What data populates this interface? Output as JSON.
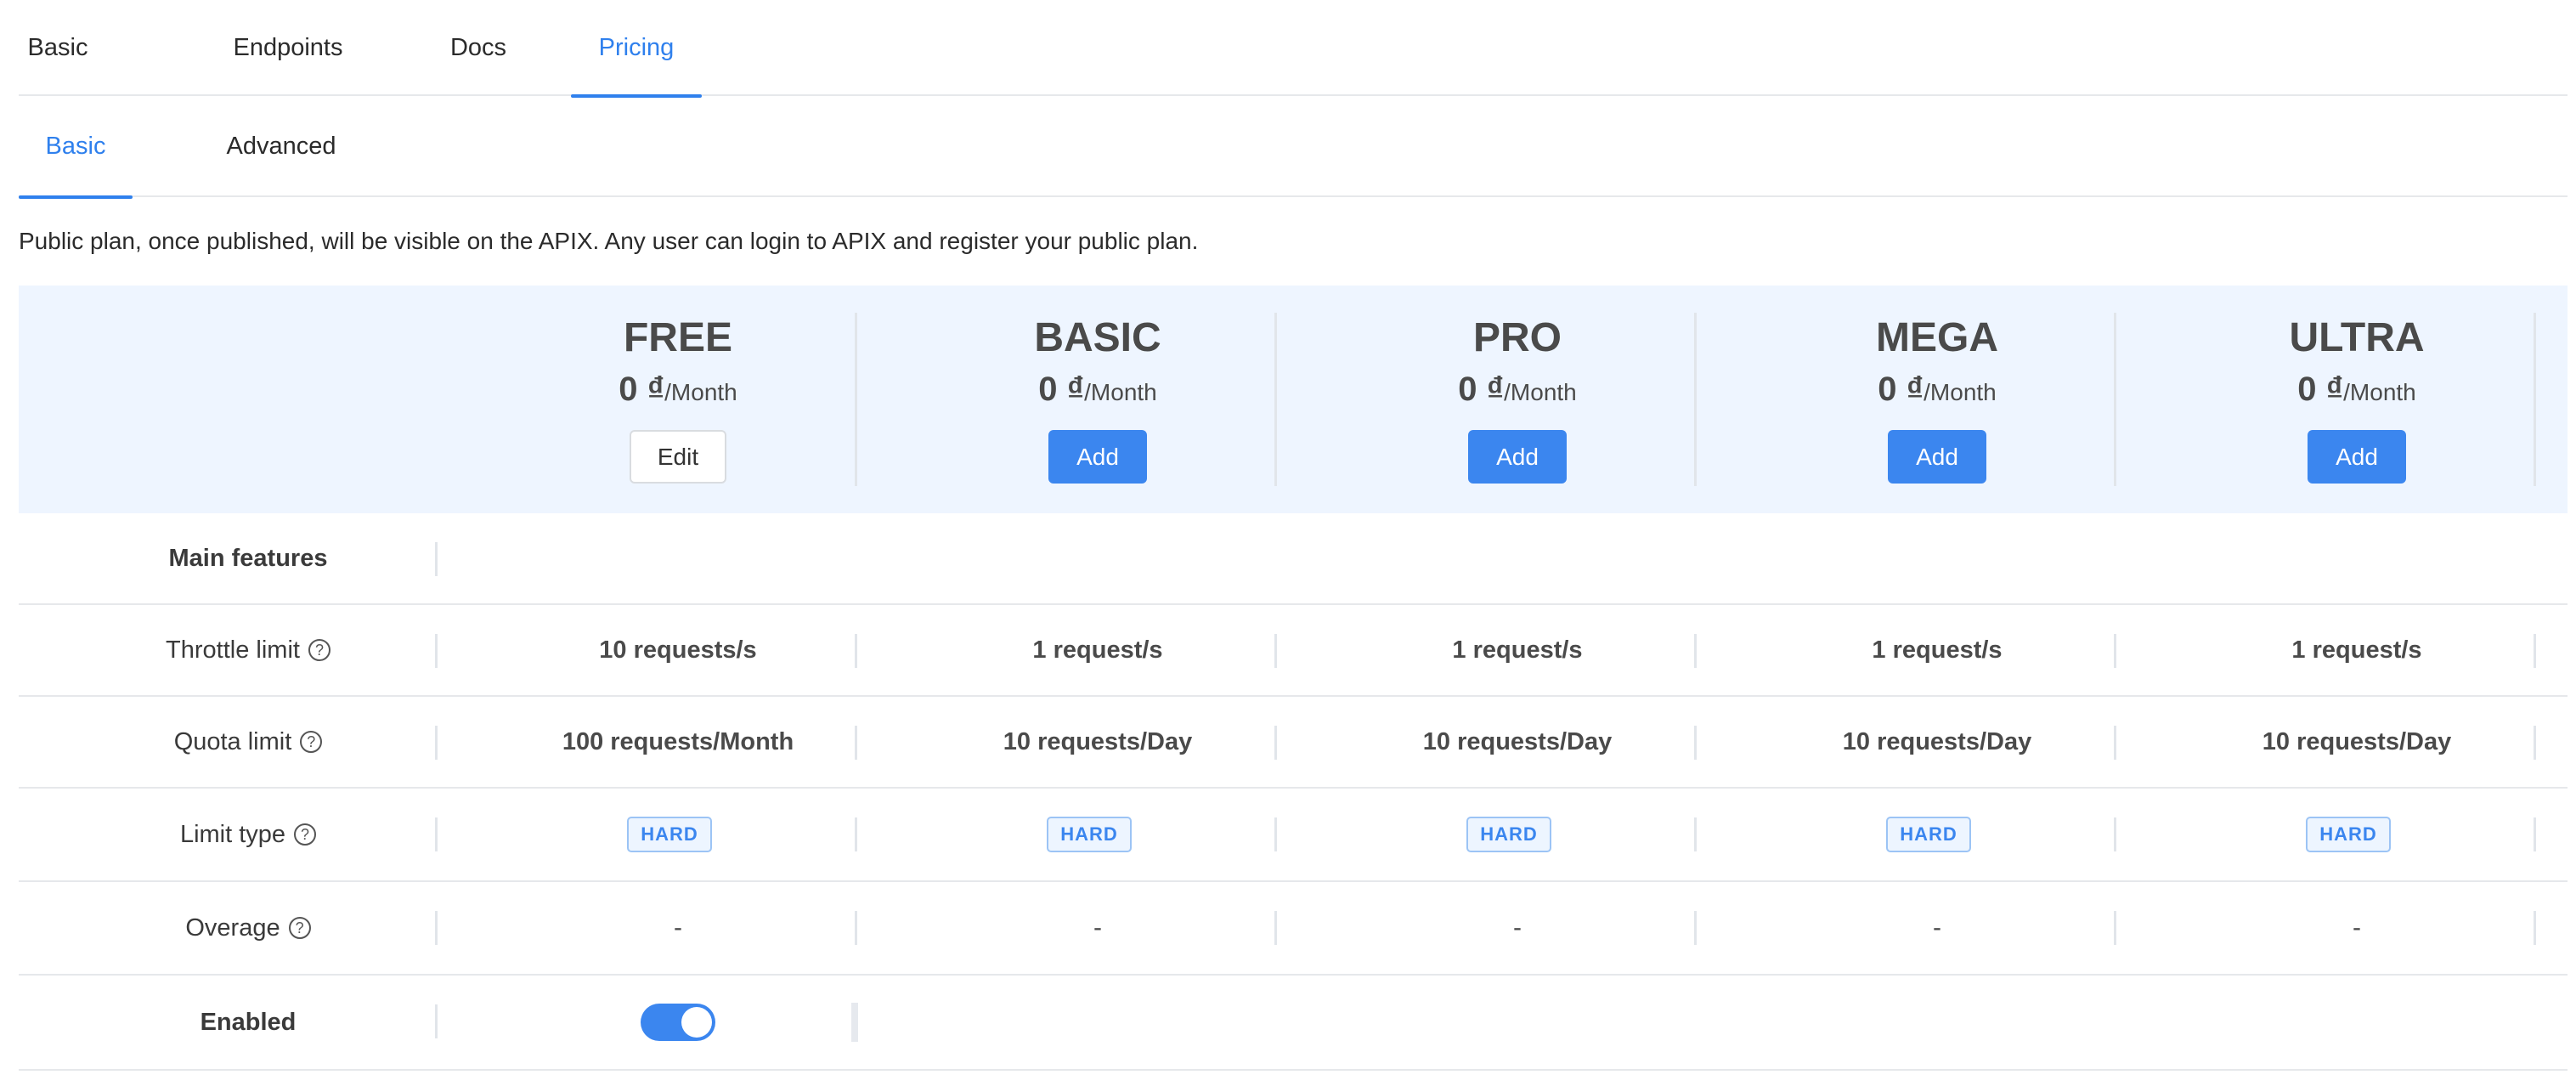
{
  "top_tabs": [
    "Basic",
    "Endpoints",
    "Docs",
    "Pricing"
  ],
  "sub_tabs": [
    "Basic",
    "Advanced"
  ],
  "description": "Public plan, once published, will be visible on the APIX. Any user can login to APIX and register your public plan.",
  "plans": [
    {
      "name": "FREE",
      "amount": "0 ₫",
      "period": "/Month",
      "button": "Edit"
    },
    {
      "name": "BASIC",
      "amount": "0 ₫",
      "period": "/Month",
      "button": "Add"
    },
    {
      "name": "PRO",
      "amount": "0 ₫",
      "period": "/Month",
      "button": "Add"
    },
    {
      "name": "MEGA",
      "amount": "0 ₫",
      "period": "/Month",
      "button": "Add"
    },
    {
      "name": "ULTRA",
      "amount": "0 ₫",
      "period": "/Month",
      "button": "Add"
    }
  ],
  "rows": {
    "main_features": "Main features",
    "throttle": {
      "label": "Throttle limit",
      "values": [
        "10 requests/s",
        "1 request/s",
        "1 request/s",
        "1 request/s",
        "1 request/s"
      ]
    },
    "quota": {
      "label": "Quota limit",
      "values": [
        "100 requests/Month",
        "10 requests/Day",
        "10 requests/Day",
        "10 requests/Day",
        "10 requests/Day"
      ]
    },
    "limit_type": {
      "label": "Limit type",
      "values": [
        "HARD",
        "HARD",
        "HARD",
        "HARD",
        "HARD"
      ]
    },
    "overage": {
      "label": "Overage",
      "values": [
        "-",
        "-",
        "-",
        "-",
        "-"
      ]
    },
    "enabled": {
      "label": "Enabled",
      "value": true
    }
  },
  "help_icon": "?",
  "colors": {
    "accent": "#3b86ef",
    "band": "#eef5ff",
    "badge_border": "#9cc4f5"
  }
}
